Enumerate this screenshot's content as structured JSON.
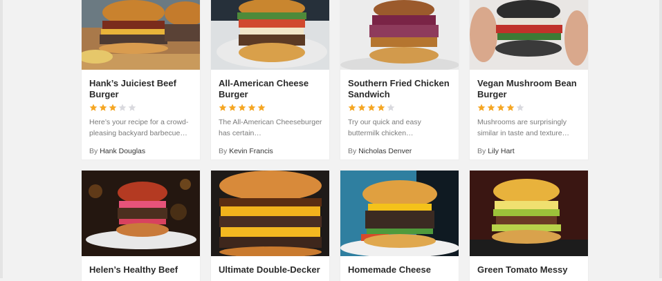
{
  "recipes": [
    {
      "title": "Hank’s Juiciest Beef Burger",
      "rating": 3,
      "description": "Here’s your recipe for a crowd-pleasing backyard barbecue…",
      "by": "By",
      "author": "Hank Douglas"
    },
    {
      "title": "All-American Cheese Burger",
      "rating": 5,
      "description": "The All-American Cheeseburger has certain…",
      "by": "By",
      "author": "Kevin Francis"
    },
    {
      "title": "Southern Fried Chicken Sandwich",
      "rating": 4,
      "description": "Try our quick and easy buttermilk chicken…",
      "by": "By",
      "author": "Nicholas Denver"
    },
    {
      "title": "Vegan Mushroom Bean Burger",
      "rating": 4,
      "description": "Mushrooms are surprisingly similar in taste and texture…",
      "by": "By",
      "author": "Lily Hart"
    },
    {
      "title": "Helen’s Healthy Beef"
    },
    {
      "title": "Ultimate Double-Decker"
    },
    {
      "title": "Homemade Cheese"
    },
    {
      "title": "Green Tomato Messy"
    }
  ],
  "colors": {
    "star_filled": "#f5a623",
    "star_empty": "#d9d9de"
  },
  "icons": {
    "star": "star-icon"
  }
}
